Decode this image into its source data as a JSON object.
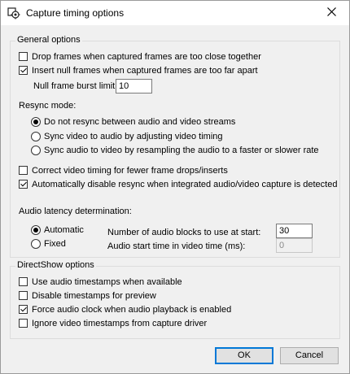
{
  "window": {
    "title": "Capture timing options",
    "app_icon": "gear-icon",
    "close_icon": "close-icon"
  },
  "general": {
    "label": "General options",
    "drop_frames": {
      "label": "Drop frames when captured frames are too close together",
      "checked": false
    },
    "insert_null": {
      "label": "Insert null frames when captured frames are too far apart",
      "checked": true
    },
    "burst_limit": {
      "label": "Null frame burst limit:",
      "value": "10"
    },
    "resync_label": "Resync mode:",
    "resync_options": [
      {
        "label": "Do not resync between audio and video streams",
        "checked": true
      },
      {
        "label": "Sync video to audio by adjusting video timing",
        "checked": false
      },
      {
        "label": "Sync audio to video by resampling the audio to a faster or slower rate",
        "checked": false
      }
    ],
    "correct_timing": {
      "label": "Correct video timing for fewer frame drops/inserts",
      "checked": false
    },
    "auto_disable": {
      "label": "Automatically disable resync when integrated audio/video capture is detected",
      "checked": true
    },
    "latency_label": "Audio latency determination:",
    "latency_options": [
      {
        "label": "Automatic",
        "checked": true
      },
      {
        "label": "Fixed",
        "checked": false
      }
    ],
    "blocks": {
      "label": "Number of audio blocks to use at start:",
      "value": "30"
    },
    "start_time": {
      "label": "Audio start time in video time (ms):",
      "value": "0"
    }
  },
  "directshow": {
    "label": "DirectShow options",
    "items": [
      {
        "label": "Use audio timestamps when available",
        "checked": false
      },
      {
        "label": "Disable timestamps for preview",
        "checked": false
      },
      {
        "label": "Force audio clock when audio playback is enabled",
        "checked": true
      },
      {
        "label": "Ignore video timestamps from capture driver",
        "checked": false
      }
    ]
  },
  "buttons": {
    "ok": "OK",
    "cancel": "Cancel"
  }
}
